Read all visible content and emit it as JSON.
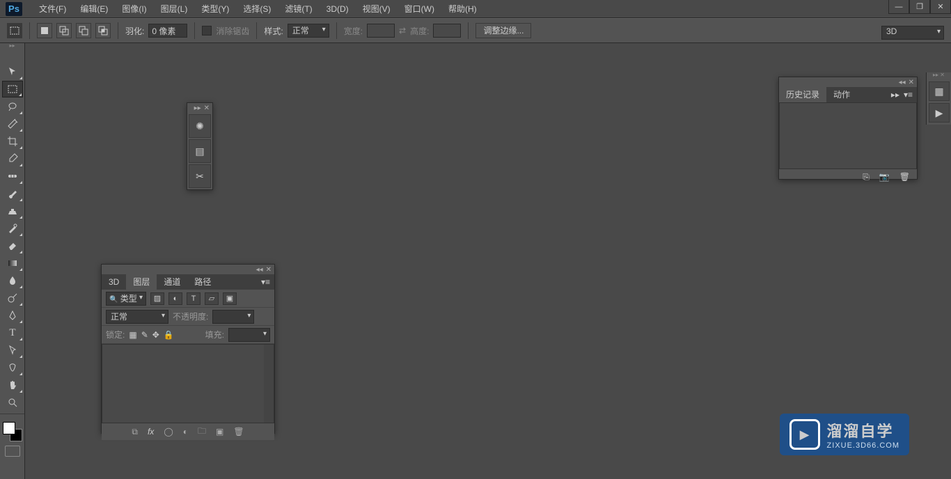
{
  "menu": [
    "文件(F)",
    "编辑(E)",
    "图像(I)",
    "图层(L)",
    "类型(Y)",
    "选择(S)",
    "滤镜(T)",
    "3D(D)",
    "视图(V)",
    "窗口(W)",
    "帮助(H)"
  ],
  "ps_logo": "Ps",
  "options": {
    "feather_label": "羽化:",
    "feather_value": "0 像素",
    "antialias": "消除锯齿",
    "style_label": "样式:",
    "style_value": "正常",
    "width_label": "宽度:",
    "height_label": "高度:",
    "refine": "调整边缘...",
    "workspace": "3D"
  },
  "layers": {
    "tabs": [
      "3D",
      "图层",
      "通道",
      "路径"
    ],
    "kind_label": "类型",
    "blend": "正常",
    "opacity_label": "不透明度:",
    "lock_label": "锁定:",
    "fill_label": "填充:"
  },
  "history": {
    "tabs": [
      "历史记录",
      "动作"
    ]
  },
  "watermark": {
    "title": "溜溜自学",
    "url": "ZIXUE.3D66.COM"
  }
}
